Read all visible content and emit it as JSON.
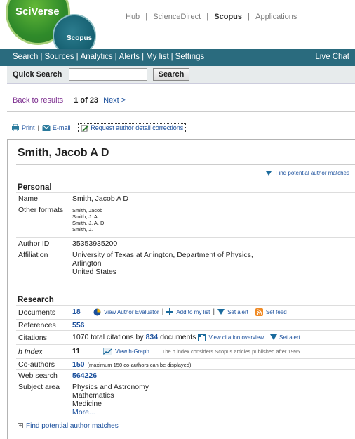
{
  "header": {
    "brand": "SciVerse",
    "product": "Scopus",
    "hub_links": [
      "Hub",
      "ScienceDirect",
      "Scopus",
      "Applications"
    ],
    "hub_selected": "Scopus"
  },
  "nav": {
    "items": [
      "Search",
      "Sources",
      "Analytics",
      "Alerts",
      "My list",
      "Settings"
    ],
    "live_chat": "Live Chat"
  },
  "quick_search": {
    "label": "Quick Search",
    "value": "",
    "button": "Search"
  },
  "pager": {
    "back": "Back to results",
    "position": "1 of 23",
    "next": "Next >"
  },
  "tools": {
    "print": "Print",
    "email": "E-mail",
    "request": "Request author detail corrections"
  },
  "author": {
    "name": "Smith, Jacob A D",
    "find_matches": "Find potential author matches",
    "personal_title": "Personal",
    "personal": {
      "name_label": "Name",
      "name_value": "Smith, Jacob A D",
      "formats_label": "Other formats",
      "formats": [
        "Smith, Jacob",
        "Smith, J. A.",
        "Smith, J. A. D.",
        "Smith, J."
      ],
      "id_label": "Author ID",
      "id_value": "35353935200",
      "affil_label": "Affiliation",
      "affil_lines": [
        "University of Texas at Arlington, Department of Physics,",
        "Arlington",
        "United States"
      ]
    },
    "research_title": "Research",
    "research": {
      "documents_label": "Documents",
      "documents_value": "18",
      "view_evaluator": "View Author Evaluator",
      "add_to_list": "Add to my list",
      "set_alert": "Set alert",
      "set_feed": "Set feed",
      "references_label": "References",
      "references_value": "556",
      "citations_label": "Citations",
      "citations_prefix": "1070 total citations by",
      "citations_docs": "834",
      "citations_suffix": "documents",
      "view_citation": "View citation overview",
      "citation_alert": "Set alert",
      "hindex_label": "h Index",
      "hindex_value": "11",
      "view_hgraph": "View h-Graph",
      "hindex_note": "The h index considers Scopus articles published after 1995.",
      "coauthors_label": "Co-authors",
      "coauthors_value": "150",
      "coauthors_note": "(maximum 150 co-authors can be displayed)",
      "websearch_label": "Web search",
      "websearch_value": "564226",
      "subject_label": "Subject area",
      "subjects": [
        "Physics and Astronomy",
        "Mathematics",
        "Medicine"
      ],
      "more": "More..."
    },
    "bottom_link": "Find potential author matches"
  }
}
